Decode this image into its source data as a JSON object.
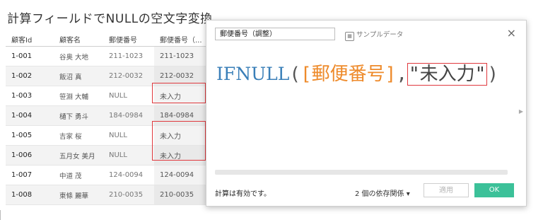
{
  "page": {
    "title": "計算フィールドでNULLの空文字変換"
  },
  "table": {
    "headers": [
      "顧客Id",
      "顧客名",
      "郵便番号",
      "郵便番号（..."
    ],
    "rows": [
      [
        "1-001",
        "谷奥 大地",
        "211-1023",
        "211-1023"
      ],
      [
        "1-002",
        "飯沼 真",
        "212-0032",
        "212-0032"
      ],
      [
        "1-003",
        "笹淵 大輔",
        "NULL",
        "未入力"
      ],
      [
        "1-004",
        "樋下 勇斗",
        "184-0984",
        "184-0984"
      ],
      [
        "1-005",
        "吉家 桜",
        "NULL",
        "未入力"
      ],
      [
        "1-006",
        "五月女 美月",
        "NULL",
        "未入力"
      ],
      [
        "1-007",
        "中道 茂",
        "124-0094",
        "124-0094"
      ],
      [
        "1-008",
        "東條 麗華",
        "210-0035",
        "210-0035"
      ]
    ]
  },
  "dialog": {
    "calc_name": "郵便番号（調整）",
    "sample_data": "サンプルデータ",
    "close": "×",
    "formula": {
      "function": "IFNULL",
      "open_paren": "(",
      "field": "[郵便番号]",
      "comma": ",",
      "string": "\"未入力\"",
      "close_paren": ")"
    },
    "status": "計算は有効です。",
    "dependencies": "2 個の依存関係 ▾",
    "apply": "適用",
    "ok": "OK"
  },
  "colors": {
    "function": "#3a7fb8",
    "field": "#ee8a2a",
    "ok_button": "#3cc199",
    "highlight": "#e0393e"
  }
}
